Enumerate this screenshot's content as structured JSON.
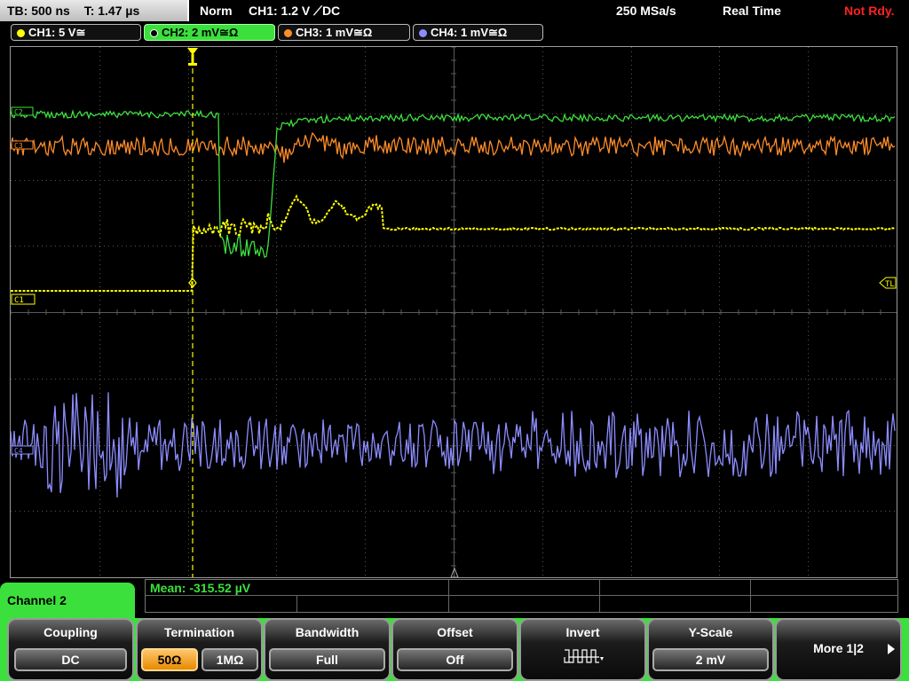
{
  "status": {
    "timebase": "TB: 500 ns",
    "trigger_time": "T: 1.47 µs",
    "trigger_mode": "Norm",
    "trigger_info": "CH1: 1.2 V ⟋DC",
    "sample_rate": "250 MSa/s",
    "acq_mode": "Real Time",
    "run_state": "Not Rdy."
  },
  "channel_tabs": [
    {
      "label": "CH1: 5 V≅",
      "color": "#ffff00"
    },
    {
      "label": "CH2: 2 mV≅Ω",
      "color": "#3ce03c"
    },
    {
      "label": "CH3: 1 mV≅Ω",
      "color": "#ff8c28"
    },
    {
      "label": "CH4: 1 mV≅Ω",
      "color": "#8c8cff"
    }
  ],
  "markers": {
    "ch1": "C1",
    "ch2": "C2",
    "ch3": "C3",
    "ch4": "C4",
    "trigger_level": "TL",
    "trigger_pos": "T"
  },
  "measurement": {
    "mean": "Mean: -315.52 µV"
  },
  "menu": {
    "title": "Channel 2",
    "coupling": {
      "label": "Coupling",
      "value": "DC"
    },
    "termination": {
      "label": "Termination",
      "opt_50": "50Ω",
      "opt_1m": "1MΩ",
      "selected": "50Ω"
    },
    "bandwidth": {
      "label": "Bandwidth",
      "value": "Full"
    },
    "offset": {
      "label": "Offset",
      "value": "Off"
    },
    "invert": {
      "label": "Invert"
    },
    "yscale": {
      "label": "Y-Scale",
      "value": "2 mV"
    },
    "more": {
      "label": "More 1|2"
    }
  }
}
